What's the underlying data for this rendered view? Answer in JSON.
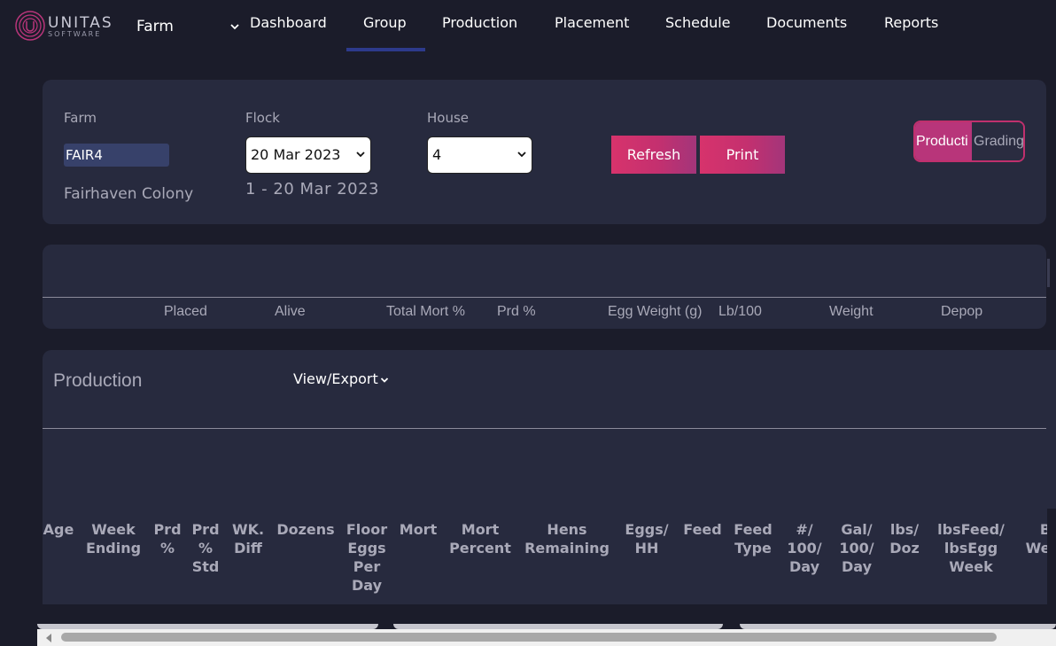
{
  "brand": {
    "name": "UNITAS",
    "tagline": "SOFTWARE"
  },
  "nav": {
    "farm_label": "Farm",
    "items": [
      {
        "label": "Dashboard"
      },
      {
        "label": "Group",
        "active": true
      },
      {
        "label": "Production"
      },
      {
        "label": "Placement"
      },
      {
        "label": "Schedule"
      },
      {
        "label": "Documents"
      },
      {
        "label": "Reports"
      }
    ]
  },
  "filters": {
    "farm_label": "Farm",
    "farm_value": "FAIR4",
    "farm_name": "Fairhaven Colony",
    "flock_label": "Flock",
    "flock_value": "20 Mar 2023",
    "flock_range": "1 - 20 Mar 2023",
    "house_label": "House",
    "house_value": "4",
    "refresh_label": "Refresh",
    "print_label": "Print",
    "toggle": {
      "production": "Producti",
      "grading": "Grading",
      "active": "production"
    }
  },
  "summary": {
    "headers": [
      "Placed",
      "Alive",
      "Total Mort %",
      "Prd %",
      "Egg Weight (g)",
      "Lb/100",
      "Weight",
      "Depop"
    ]
  },
  "production": {
    "title": "Production",
    "view_export_label": "View/Export",
    "columns": [
      [
        "Age"
      ],
      [
        "Week",
        "Ending"
      ],
      [
        "Prd",
        "%"
      ],
      [
        "Prd",
        "%",
        "Std"
      ],
      [
        "WK.",
        "Diff"
      ],
      [
        "Dozens"
      ],
      [
        "Floor",
        "Eggs",
        "Per",
        "Day"
      ],
      [
        "Mort"
      ],
      [
        "Mort",
        "Percent"
      ],
      [
        "Hens",
        "Remaining"
      ],
      [
        "Eggs/",
        "HH"
      ],
      [
        "Feed"
      ],
      [
        "Feed",
        "Type"
      ],
      [
        "#/",
        "100/",
        "Day"
      ],
      [
        "Gal/",
        "100/",
        "Day"
      ],
      [
        "lbs/",
        "Doz"
      ],
      [
        "lbsFeed/",
        "lbsEgg",
        "Week"
      ],
      [
        "B",
        "Weig"
      ]
    ]
  },
  "colors": {
    "background": "#1b1c2a",
    "card": "#272a3e",
    "accent": "#d7336c",
    "nav_underline": "#2d3a8c"
  }
}
